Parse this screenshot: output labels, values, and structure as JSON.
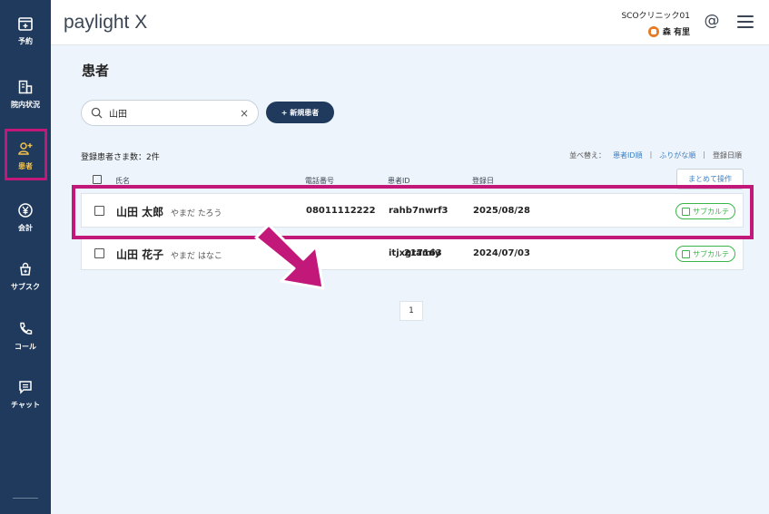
{
  "sidebar": {
    "items": [
      {
        "label": "予約",
        "icon": "calendar-icon"
      },
      {
        "label": "院内状況",
        "icon": "building-icon"
      },
      {
        "label": "患者",
        "icon": "patient-add-icon"
      },
      {
        "label": "会計",
        "icon": "yen-icon"
      },
      {
        "label": "サブスク",
        "icon": "subscription-icon"
      },
      {
        "label": "コール",
        "icon": "phone-icon"
      },
      {
        "label": "チャット",
        "icon": "chat-icon"
      }
    ],
    "active": "患者"
  },
  "header": {
    "logo": "paylight X",
    "clinic": "SCOクリニック01",
    "user": "森 有里"
  },
  "page": {
    "title": "患者"
  },
  "search": {
    "value": "山田",
    "clear": "×"
  },
  "new_patient_button": "+ 新規患者",
  "count_label": "登録患者さま数：2件",
  "sort": {
    "label": "並べ替え：",
    "options": [
      "患者ID順",
      "ふりがな順",
      "登録日順"
    ],
    "separator": "|"
  },
  "table": {
    "headers": [
      "氏名",
      "電話番号",
      "患者ID",
      "登録日"
    ],
    "bulk_action": "まとめて操作",
    "karte_label": "サブカルテ",
    "rows": [
      {
        "name": "山田 太郎",
        "kana": "やまだ たろう",
        "phone": "08011112222",
        "patient_id": "rahb7nwrf3",
        "registered": "2025/08/28"
      },
      {
        "name": "山田 花子",
        "kana": "やまだ はなこ",
        "phone": "217163",
        "patient_id": "itjxgramiy",
        "registered": "2024/07/03"
      }
    ]
  },
  "pagination": {
    "current": "1"
  },
  "colors": {
    "sidebar_bg": "#1f3a5c",
    "accent": "#f3c24a",
    "highlight": "#c2187a",
    "link": "#3d7fc2",
    "karte_green": "#3ab54a"
  }
}
